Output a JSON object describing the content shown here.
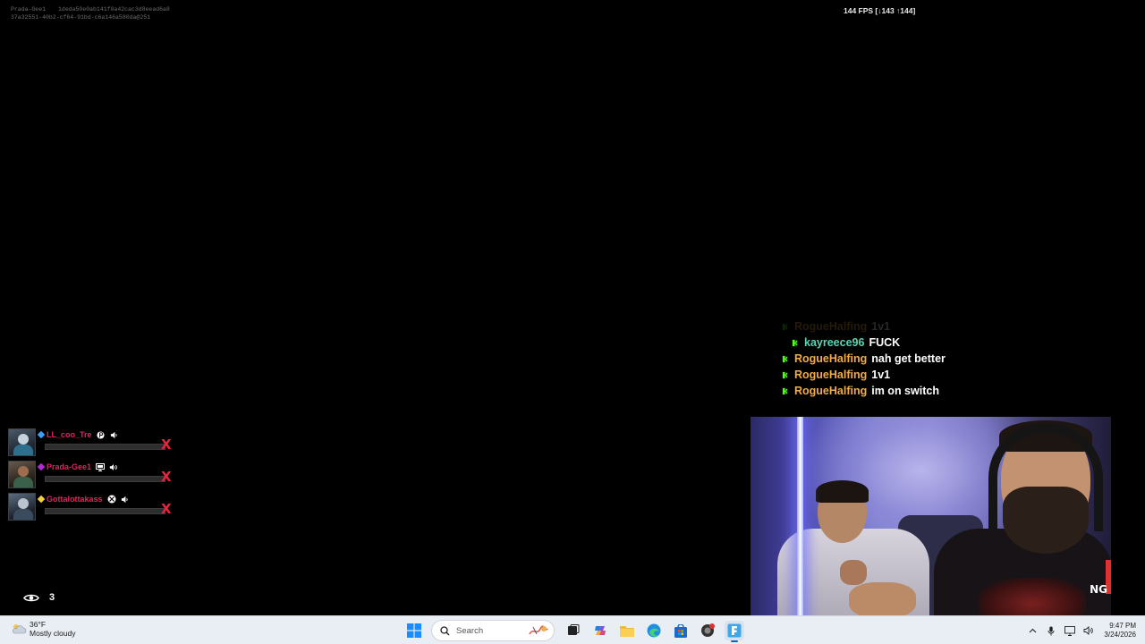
{
  "debug": {
    "player": "Prada-Gee1",
    "hash1": "1deda50e0ab141f0a42cac3d8eead6a8",
    "hash2": "37a32551-40b2-cf64-91bd-c6a146a580da@251"
  },
  "fps": {
    "text": "144 FPS [↓143 ↑144]"
  },
  "chat": {
    "messages": [
      {
        "user": "RogueHalfing",
        "text": "1v1",
        "user_color": "#f2ac43",
        "faded": true
      },
      {
        "user": "kayreece96",
        "text": "FUCK",
        "user_color": "#5ad3b3",
        "faded": false
      },
      {
        "user": "RogueHalfing",
        "text": "nah get better",
        "user_color": "#f2ac43",
        "faded": false
      },
      {
        "user": "RogueHalfing",
        "text": "1v1",
        "user_color": "#f2ac43",
        "faded": false
      },
      {
        "user": "RogueHalfing",
        "text": "im on switch",
        "user_color": "#f2ac43",
        "faded": false
      }
    ],
    "platform_icon": "kick-icon",
    "platform_color": "#53fc18"
  },
  "party": {
    "members": [
      {
        "name": "LL_coo_Tre",
        "platform_icon": "playstation-icon",
        "rank_color": "#3aa0ff",
        "remove_label": "X"
      },
      {
        "name": "Prada-Gee1",
        "platform_icon": "pc-icon",
        "rank_color": "#b22bd8",
        "remove_label": "X"
      },
      {
        "name": "Gottalottakass",
        "platform_icon": "xbox-icon",
        "rank_color": "#f4d03f",
        "remove_label": "X"
      }
    ]
  },
  "viewers": {
    "count": "3",
    "icon": "eye-icon"
  },
  "webcam": {
    "overlay_text": "NG"
  },
  "taskbar": {
    "weather": {
      "temp": "36°F",
      "condition": "Mostly cloudy"
    },
    "search_placeholder": "Search",
    "apps": [
      "start-icon",
      "task-view-icon",
      "copilot-icon",
      "file-explorer-icon",
      "edge-icon",
      "store-icon",
      "game-app-icon",
      "fortnite-icon"
    ],
    "clock": {
      "time": "9:47 PM",
      "date": "3/24/2026"
    }
  }
}
